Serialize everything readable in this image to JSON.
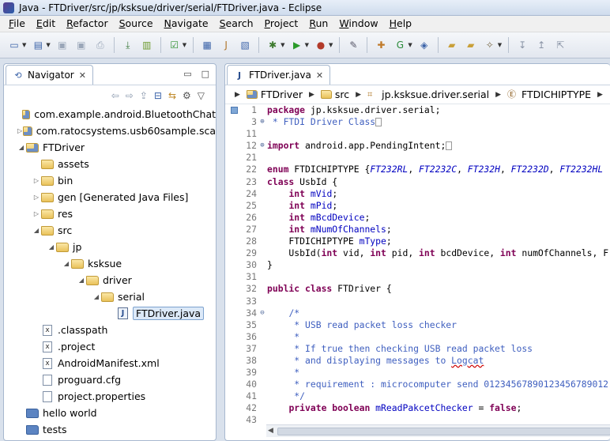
{
  "window": {
    "title": "Java - FTDriver/src/jp/ksksue/driver/serial/FTDriver.java - Eclipse"
  },
  "menu": [
    "File",
    "Edit",
    "Refactor",
    "Source",
    "Navigate",
    "Search",
    "Project",
    "Run",
    "Window",
    "Help"
  ],
  "navigator": {
    "tab_label": "Navigator",
    "tree": [
      {
        "label": "com.example.android.BluetoothChat",
        "depth": 0,
        "arrow": "",
        "icon": "proj"
      },
      {
        "label": "com.ratocsystems.usb60sample.sca",
        "depth": 0,
        "arrow": "▷",
        "icon": "proj"
      },
      {
        "label": "FTDriver",
        "depth": 0,
        "arrow": "◢",
        "icon": "proj"
      },
      {
        "label": "assets",
        "depth": 1,
        "arrow": "",
        "icon": "folder"
      },
      {
        "label": "bin",
        "depth": 1,
        "arrow": "▷",
        "icon": "folder"
      },
      {
        "label": "gen [Generated Java Files]",
        "depth": 1,
        "arrow": "▷",
        "icon": "folder"
      },
      {
        "label": "res",
        "depth": 1,
        "arrow": "▷",
        "icon": "folder"
      },
      {
        "label": "src",
        "depth": 1,
        "arrow": "◢",
        "icon": "folder"
      },
      {
        "label": "jp",
        "depth": 2,
        "arrow": "◢",
        "icon": "folder"
      },
      {
        "label": "ksksue",
        "depth": 3,
        "arrow": "◢",
        "icon": "folder"
      },
      {
        "label": "driver",
        "depth": 4,
        "arrow": "◢",
        "icon": "folder"
      },
      {
        "label": "serial",
        "depth": 5,
        "arrow": "◢",
        "icon": "folder"
      },
      {
        "label": "FTDriver.java",
        "depth": 6,
        "arrow": "",
        "icon": "java",
        "selected": true
      },
      {
        "label": ".classpath",
        "depth": 1,
        "arrow": "",
        "icon": "xfile"
      },
      {
        "label": ".project",
        "depth": 1,
        "arrow": "",
        "icon": "xfile"
      },
      {
        "label": "AndroidManifest.xml",
        "depth": 1,
        "arrow": "",
        "icon": "xfile"
      },
      {
        "label": "proguard.cfg",
        "depth": 1,
        "arrow": "",
        "icon": "file"
      },
      {
        "label": "project.properties",
        "depth": 1,
        "arrow": "",
        "icon": "file"
      },
      {
        "label": "hello world",
        "depth": 0,
        "arrow": "",
        "icon": "plain"
      },
      {
        "label": "tests",
        "depth": 0,
        "arrow": "",
        "icon": "plain"
      }
    ]
  },
  "editor": {
    "tab_label": "FTDriver.java",
    "breadcrumb": [
      "FTDriver",
      "src",
      "jp.ksksue.driver.serial",
      "FTDICHIPTYPE"
    ],
    "lines": [
      {
        "n": "1",
        "fold": "",
        "html": "<span class=\"kw\">package</span> jp.ksksue.driver.serial;"
      },
      {
        "n": "3",
        "fold": "⊕",
        "html": "<span class=\"cm\"> * FTDI Driver Class</span><span style=\"border:1px solid #999;display:inline-block;width:8px;height:11px;vertical-align:middle\"></span>"
      },
      {
        "n": "11",
        "fold": "",
        "html": ""
      },
      {
        "n": "12",
        "fold": "⊕",
        "html": "<span class=\"kw\">import</span> android.app.PendingIntent;<span style=\"border:1px solid #999;display:inline-block;width:8px;height:11px;vertical-align:middle\"></span>"
      },
      {
        "n": "21",
        "fold": "",
        "html": ""
      },
      {
        "n": "22",
        "fold": "",
        "html": "<span class=\"kw\">enum</span> FTDICHIPTYPE {<span class=\"fld\">FT232RL</span>, <span class=\"fld\">FT2232C</span>, <span class=\"fld\">FT232H</span>, <span class=\"fld\">FT2232D</span>, <span class=\"fld\">FT2232HL</span>"
      },
      {
        "n": "23",
        "fold": "",
        "html": "<span class=\"kw\">class</span> UsbId {"
      },
      {
        "n": "24",
        "fold": "",
        "html": "    <span class=\"kw\">int</span> <span class=\"fldn\">mVid</span>;"
      },
      {
        "n": "25",
        "fold": "",
        "html": "    <span class=\"kw\">int</span> <span class=\"fldn\">mPid</span>;"
      },
      {
        "n": "26",
        "fold": "",
        "html": "    <span class=\"kw\">int</span> <span class=\"fldn\">mBcdDevice</span>;"
      },
      {
        "n": "27",
        "fold": "",
        "html": "    <span class=\"kw\">int</span> <span class=\"fldn\">mNumOfChannels</span>;"
      },
      {
        "n": "28",
        "fold": "",
        "html": "    FTDICHIPTYPE <span class=\"fldn\">mType</span>;"
      },
      {
        "n": "29",
        "fold": "",
        "html": "    UsbId(<span class=\"kw\">int</span> vid, <span class=\"kw\">int</span> pid, <span class=\"kw\">int</span> bcdDevice, <span class=\"kw\">int</span> numOfChannels, F"
      },
      {
        "n": "30",
        "fold": "",
        "html": "}"
      },
      {
        "n": "31",
        "fold": "",
        "html": ""
      },
      {
        "n": "32",
        "fold": "",
        "html": "<span class=\"kw\">public class</span> FTDriver {"
      },
      {
        "n": "33",
        "fold": "",
        "html": ""
      },
      {
        "n": "34",
        "fold": "⊖",
        "html": "    <span class=\"cm\">/*</span>"
      },
      {
        "n": "35",
        "fold": "",
        "html": "<span class=\"cm\">     * USB read packet loss checker</span>"
      },
      {
        "n": "36",
        "fold": "",
        "html": "<span class=\"cm\">     *</span>"
      },
      {
        "n": "37",
        "fold": "",
        "html": "<span class=\"cm\">     * If true then checking USB read packet loss</span>"
      },
      {
        "n": "38",
        "fold": "",
        "html": "<span class=\"cm\">     * and displaying messages to <u style=\"text-decoration-style:wavy;text-decoration-color:#c00\">Logcat</u></span>"
      },
      {
        "n": "39",
        "fold": "",
        "html": "<span class=\"cm\">     *</span>"
      },
      {
        "n": "40",
        "fold": "",
        "html": "<span class=\"cm\">     * requirement : microcomputer send 01234567890123456789012</span>"
      },
      {
        "n": "41",
        "fold": "",
        "html": "<span class=\"cm\">     */</span>"
      },
      {
        "n": "42",
        "fold": "",
        "html": "    <span class=\"kw\">private boolean</span> <span class=\"fldn\">mReadPakcetChecker</span> = <span class=\"kw\">false</span>;"
      },
      {
        "n": "43",
        "fold": "",
        "html": ""
      }
    ]
  }
}
